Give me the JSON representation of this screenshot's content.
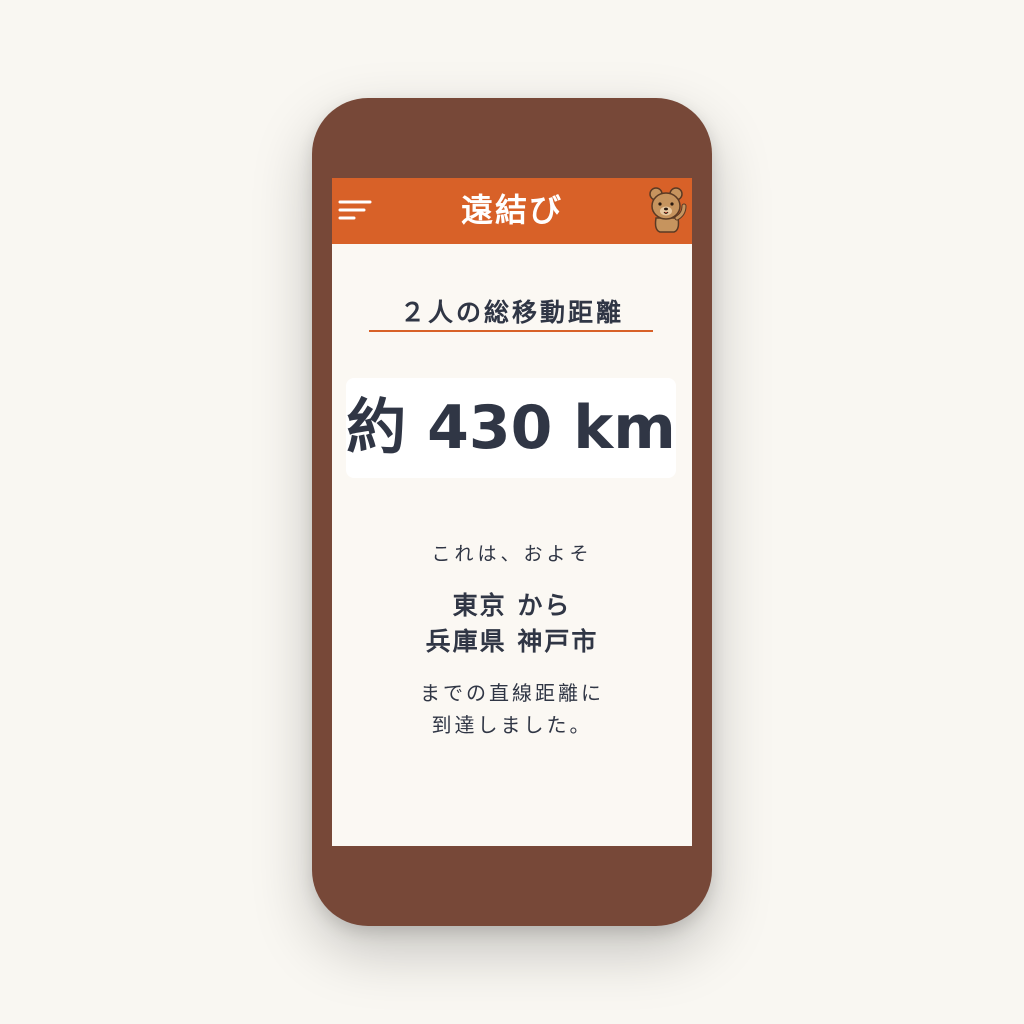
{
  "app": {
    "title": "遠結び",
    "accent_color": "#d86128",
    "device_color": "#774838",
    "text_color": "#303645"
  },
  "header": {
    "menu_icon": "hamburger-menu-icon",
    "mascot_icon": "bear-mascot-icon"
  },
  "main": {
    "section_title": "２人の総移動距離",
    "distance": "約 430 km",
    "intro": "これは、およそ",
    "from_place": "東京 から",
    "to_place": "兵庫県 神戸市",
    "outro_line1": "までの直線距離に",
    "outro_line2": "到達しました。"
  }
}
